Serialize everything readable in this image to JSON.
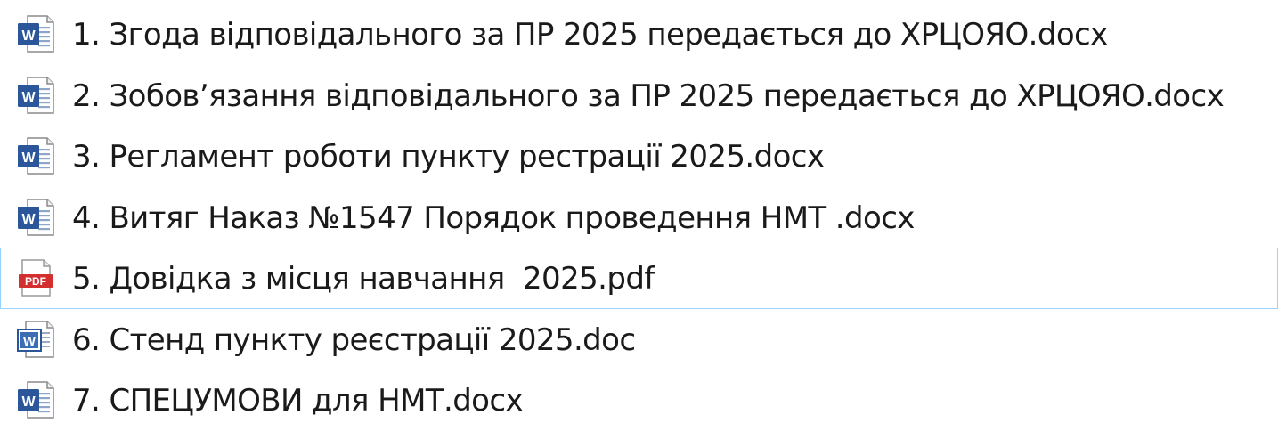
{
  "files": [
    {
      "name": "1. Згода відповідального за ПР 2025 передається до ХРЦОЯО.docx",
      "icon": "word-docx-icon",
      "selected": false
    },
    {
      "name": "2. Зобов’язання відповідального за ПР 2025 передається до ХРЦОЯО.docx",
      "icon": "word-docx-icon",
      "selected": false
    },
    {
      "name": "3. Регламент роботи пункту рестрації 2025.docx",
      "icon": "word-docx-icon",
      "selected": false
    },
    {
      "name": "4. Витяг Наказ №1547 Порядок проведення НМТ .docx",
      "icon": "word-docx-icon",
      "selected": false
    },
    {
      "name": "5. Довідка з місця навчання  2025.pdf",
      "icon": "pdf-icon",
      "selected": true,
      "icon_badge": "PDF"
    },
    {
      "name": "6. Стенд пункту реєстрації 2025.doc",
      "icon": "word-doc-icon",
      "selected": false
    },
    {
      "name": "7. СПЕЦУМОВИ для НМТ.docx",
      "icon": "word-docx-icon",
      "selected": false
    }
  ],
  "colors": {
    "word_blue": "#2b579a",
    "pdf_red": "#d32f2f",
    "selection_border": "#99d1ff"
  }
}
